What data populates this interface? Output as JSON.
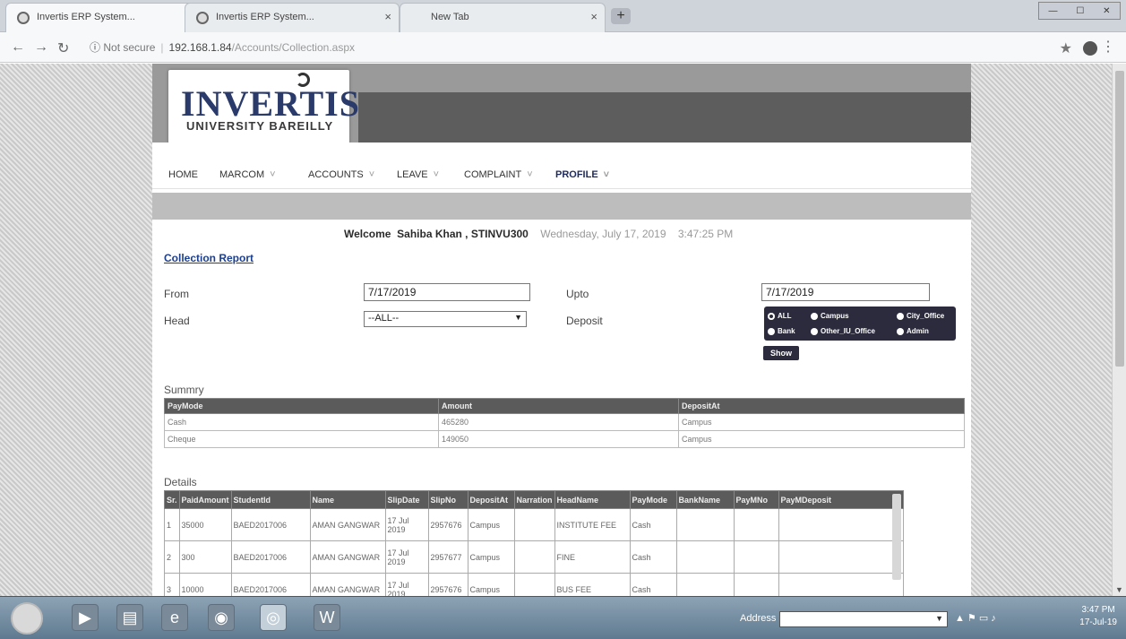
{
  "browser": {
    "tabs": [
      {
        "title": "Invertis ERP System..."
      },
      {
        "title": "Invertis ERP System..."
      },
      {
        "title": "New Tab"
      }
    ],
    "new_tab_label": "+",
    "url_security": "Not secure",
    "url_host": "192.168.1.84",
    "url_path": "/Accounts/Collection.aspx"
  },
  "logo": {
    "line1": "INVERTIS",
    "line2": "UNIVERSITY BAREILLY"
  },
  "menu": {
    "items": [
      {
        "label": "HOME",
        "caret": ""
      },
      {
        "label": "MARCOM",
        "caret": "˅"
      },
      {
        "label": "ACCOUNTS",
        "caret": "˅"
      },
      {
        "label": "LEAVE",
        "caret": "˅"
      },
      {
        "label": "COMPLAINT",
        "caret": "˅"
      },
      {
        "label": "PROFILE",
        "caret": "˅"
      }
    ]
  },
  "welcome": {
    "prefix": "Welcome",
    "user": "Sahiba Khan , STINVU300",
    "date": "Wednesday, July 17, 2019",
    "time": "3:47:25 PM"
  },
  "report": {
    "title": "Collection Report",
    "from_label": "From",
    "from_value": "7/17/2019",
    "upto_label": "Upto",
    "upto_value": "7/17/2019",
    "head_label": "Head",
    "head_value": "--ALL--",
    "deposit_label": "Deposit",
    "deposit_options": [
      "ALL",
      "Campus",
      "City_Office",
      "Bank",
      "Other_IU_Office",
      "Admin"
    ],
    "deposit_selected": "ALL",
    "show_label": "Show"
  },
  "summary": {
    "title": "Summry",
    "headers": [
      "PayMode",
      "Amount",
      "DepositAt"
    ],
    "rows": [
      [
        "Cash",
        "465280",
        "Campus"
      ],
      [
        "Cheque",
        "149050",
        "Campus"
      ]
    ]
  },
  "details": {
    "title": "Details",
    "headers": [
      "Sr.",
      "PaidAmount",
      "StudentId",
      "Name",
      "SlipDate",
      "SlipNo",
      "DepositAt",
      "Narration",
      "HeadName",
      "PayMode",
      "BankName",
      "PayMNo",
      "PayMDeposit"
    ],
    "rows": [
      [
        "1",
        "35000",
        "BAED2017006",
        "AMAN GANGWAR",
        "17 Jul 2019",
        "2957676",
        "Campus",
        "",
        "INSTITUTE FEE",
        "Cash",
        "",
        "",
        ""
      ],
      [
        "2",
        "300",
        "BAED2017006",
        "AMAN GANGWAR",
        "17 Jul 2019",
        "2957677",
        "Campus",
        "",
        "FINE",
        "Cash",
        "",
        "",
        ""
      ],
      [
        "3",
        "10000",
        "BAED2017006",
        "AMAN GANGWAR",
        "17 Jul 2019",
        "2957676",
        "Campus",
        "",
        "BUS FEE",
        "Cash",
        "",
        "",
        ""
      ]
    ]
  },
  "taskbar": {
    "address_label": "Address",
    "clock_time": "3:47 PM",
    "clock_date": "17-Jul-19"
  },
  "colors": {
    "header_gray": "#9a9a9a",
    "header_dark": "#5d5d5d",
    "table_header": "#5b5b5b",
    "link_blue": "#1c3f8f",
    "radio_panel": "#2b2b3d"
  }
}
